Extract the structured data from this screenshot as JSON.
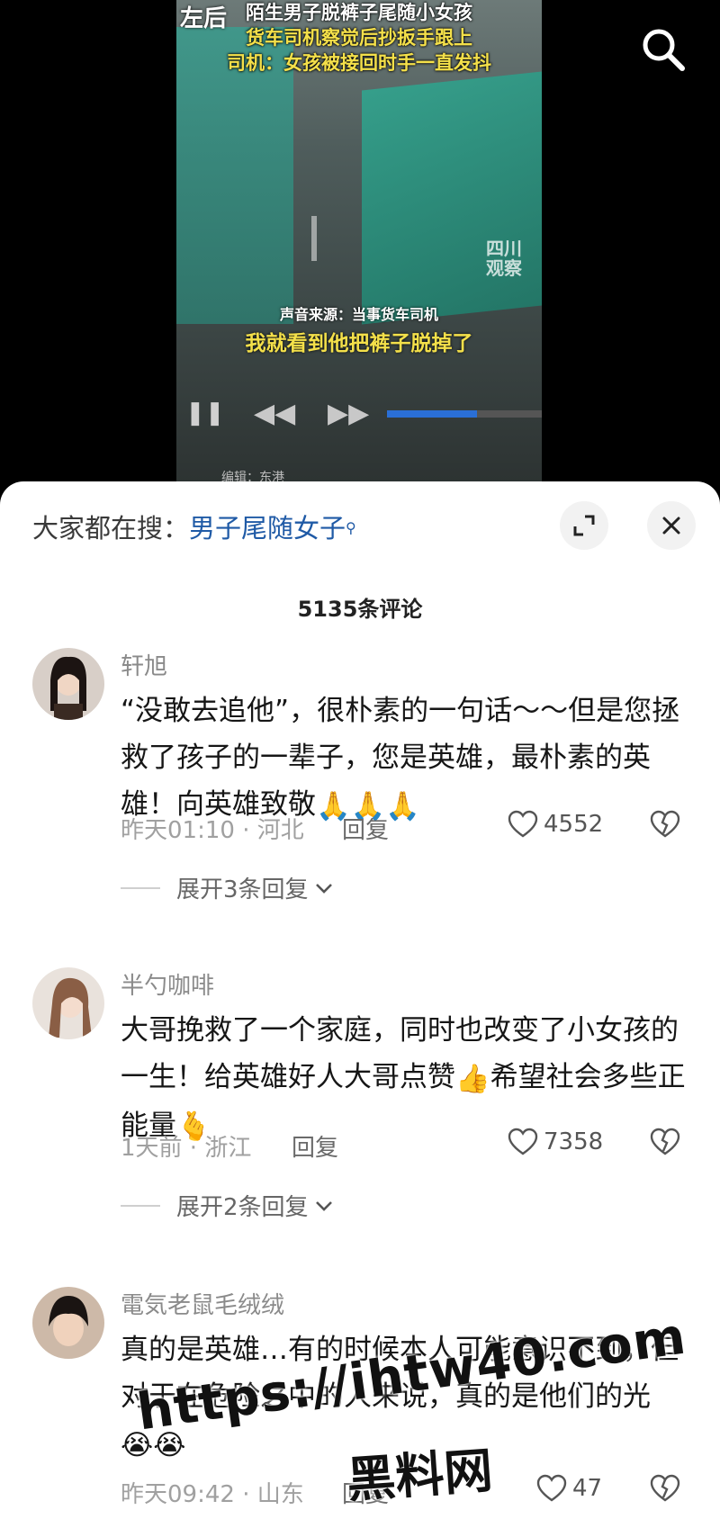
{
  "video": {
    "overlay_left": "左后",
    "overlay_lines": [
      "陌生男子脱裤子尾随小女孩",
      "货车司机察觉后抄扳手跟上",
      "司机：女孩被接回时手一直发抖"
    ],
    "watermark": "四川观察",
    "source_text": "声音来源：当事货车司机",
    "quote_text": "我就看到他把裤子脱掉了",
    "bottom_text": "编辑：东港",
    "progress": 0.58
  },
  "search_icon": "search-icon",
  "sheet": {
    "hot_search_prefix": "大家都在搜：",
    "hot_search_term": "男子尾随女子",
    "comment_count": "5135条评论"
  },
  "comments": [
    {
      "user": "轩旭",
      "text": "“没敢去追他”，很朴素的一句话～～但是您拯救了孩子的一辈子，您是英雄，最朴素的英雄！向英雄致敬",
      "emoji": "🙏🙏🙏",
      "meta": "昨天01:10 · 河北",
      "reply": "回复",
      "likes": "4552",
      "expand": "展开3条回复"
    },
    {
      "user": "半勺咖啡",
      "text_a": "大哥挽救了一个家庭，同时也改变了小女孩的一生！给英雄好人大哥点赞",
      "emoji_a": "👍",
      "text_b": "希望社会多些正能量",
      "emoji_b": "🫰",
      "meta": "1天前 · 浙江",
      "reply": "回复",
      "likes": "7358",
      "expand": "展开2条回复"
    },
    {
      "user": "電気老鼠毛绒绒",
      "text": "真的是英雄…有的时候本人可能意识不到，但对于在危险之中的人来说，真的是他们的光",
      "emoji": "😭😭",
      "meta": "昨天09:42 · 山东",
      "reply": "回复",
      "likes": "47"
    }
  ],
  "site_watermark": {
    "url": "https://ihtw40.com",
    "name": "黑料网"
  },
  "colors": {
    "accent_link": "#1f5aa6",
    "caption_yellow": "#f4e04a",
    "sheet_bg": "#ffffff"
  }
}
